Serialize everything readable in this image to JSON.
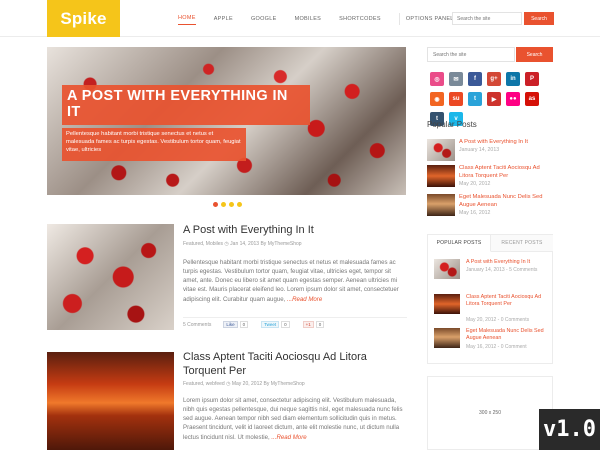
{
  "header": {
    "logo": "Spike",
    "nav": [
      "HOME",
      "APPLE",
      "GOOGLE",
      "MOBILES",
      "SHORTCODES",
      "OPTIONS PANEL"
    ],
    "search_placeholder": "Search the site",
    "search_button": "Search"
  },
  "slider": {
    "title": "A POST WITH EVERYTHING IN IT",
    "excerpt": "Pellentesque habitant morbi tristique senectus et netus et malesuada fames ac turpis egestas. Vestibulum tortor quam, feugiat vitae, ultricies"
  },
  "posts": [
    {
      "title": "A Post with Everything In It",
      "meta": "Featured, Mobiles  ◷  Jan 14, 2013 By MyThemeShop",
      "excerpt": "Pellentesque habitant morbi tristique senectus et netus et malesuada fames ac turpis egestas. Vestibulum tortor quam, feugiat vitae, ultricies eget, tempor sit amet, ante. Donec eu libero sit amet quam egestas semper. Aenean ultricies mi vitae est. Mauris placerat eleifend leo. Lorem ipsum dolor sit amet, consectetuer adipiscing elit. Curabitur quam augue,",
      "read_more": " ...Read More",
      "comments": "5 Comments",
      "like_label": "Like",
      "like_count": "0",
      "tweet_label": "Tweet",
      "tweet_count": "0",
      "plus_label": "+1",
      "plus_count": "0"
    },
    {
      "title": "Class Aptent Taciti Aociosqu Ad Litora Torquent Per",
      "meta": "Featured, webfeed  ◷  May 20, 2012 By MyThemeShop",
      "excerpt": "Lorem ipsum dolor sit amet, consectetur adipiscing elit. Vestibulum malesuada, nibh quis egestas pellentesque, dui neque sagittis nisl, eget malesuada nunc felis sed augue. Aenean tempor nibh sed diam elementum sollicitudin quis in metus. Praesent tincidunt, velit id laoreet dictum, ante elit molestie nunc, ut dictum nulla lectus tincidunt nisl. Ut molestie,",
      "read_more": " ...Read More"
    }
  ],
  "sidebar": {
    "search_placeholder": "Search the site",
    "search_button": "Search",
    "social": [
      {
        "name": "dribbble-icon",
        "glyph": "◎",
        "color": "#ea4c89"
      },
      {
        "name": "mail-icon",
        "glyph": "✉",
        "color": "#7a8a99"
      },
      {
        "name": "facebook-icon",
        "glyph": "f",
        "color": "#3b5998"
      },
      {
        "name": "googleplus-icon",
        "glyph": "g+",
        "color": "#d34836"
      },
      {
        "name": "linkedin-icon",
        "glyph": "in",
        "color": "#0e76a8"
      },
      {
        "name": "pinterest-icon",
        "glyph": "P",
        "color": "#cb2027"
      },
      {
        "name": "rss-icon",
        "glyph": "◉",
        "color": "#f26522"
      },
      {
        "name": "stumbleupon-icon",
        "glyph": "su",
        "color": "#eb4924"
      },
      {
        "name": "twitter-icon",
        "glyph": "t",
        "color": "#2aa3d9"
      },
      {
        "name": "youtube-icon",
        "glyph": "▶",
        "color": "#cd332d"
      },
      {
        "name": "flickr-icon",
        "glyph": "●●",
        "color": "#ff0084"
      },
      {
        "name": "lastfm-icon",
        "glyph": "as",
        "color": "#d51007"
      },
      {
        "name": "tumblr-icon",
        "glyph": "t",
        "color": "#34526f"
      },
      {
        "name": "vimeo-icon",
        "glyph": "v",
        "color": "#1ab7ea"
      }
    ],
    "popular_title": "Popular Posts",
    "popular": [
      {
        "title": "A Post with Everything In It",
        "date": "January 14, 2013"
      },
      {
        "title": "Class Aptent Taciti Aociosqu Ad Litora Torquent Per",
        "date": "May 20, 2012"
      },
      {
        "title": "Eget Malesuada Nunc Delis Sed Augue Aenean",
        "date": "May 16, 2012"
      }
    ],
    "tabs": {
      "popular_label": "POPULAR POSTS",
      "recent_label": "RECENT POSTS",
      "items": [
        {
          "title": "A Post with Everything In It",
          "date": "January 14, 2013 - 5 Comments"
        },
        {
          "title": "Class Aptent Taciti Aociosqu Ad Litora Torquent Per",
          "date": "May 20, 2012 - 0 Comments"
        },
        {
          "title": "Eget Malesuada Nunc Delis Sed Augue Aenean",
          "date": "May 16, 2012 - 0 Comment"
        }
      ]
    },
    "ad_label": "300 x 250"
  },
  "version_badge": "v1.0",
  "colors": {
    "accent": "#e9522f",
    "logo_bg": "#f5c51a"
  }
}
